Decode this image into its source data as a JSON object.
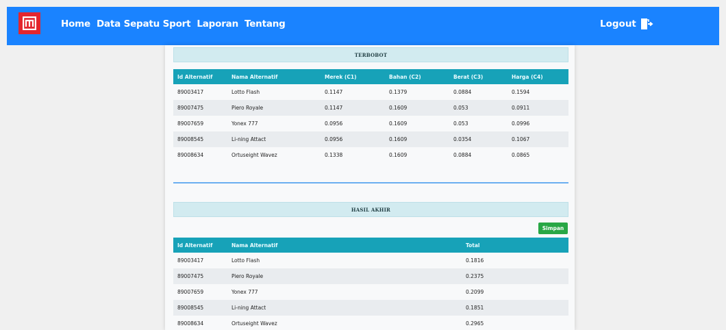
{
  "nav": {
    "items": [
      {
        "label": "Home"
      },
      {
        "label": "Data Sepatu Sport"
      },
      {
        "label": "Laporan"
      },
      {
        "label": "Tentang"
      }
    ],
    "logout_label": "Logout"
  },
  "terbobot": {
    "title": "TERBOBOT",
    "headers": [
      "Id Alternatif",
      "Nama Alternatif",
      "Merek (C1)",
      "Bahan (C2)",
      "Berat (C3)",
      "Harga (C4)"
    ],
    "rows": [
      [
        "89003417",
        "Lotto Flash",
        "0.1147",
        "0.1379",
        "0.0884",
        "0.1594"
      ],
      [
        "89007475",
        "Piero Royale",
        "0.1147",
        "0.1609",
        "0.053",
        "0.0911"
      ],
      [
        "89007659",
        "Yonex 777",
        "0.0956",
        "0.1609",
        "0.053",
        "0.0996"
      ],
      [
        "89008545",
        "Li-ning Attact",
        "0.0956",
        "0.1609",
        "0.0354",
        "0.1067"
      ],
      [
        "89008634",
        "Ortuseight Wavez",
        "0.1338",
        "0.1609",
        "0.0884",
        "0.0865"
      ]
    ]
  },
  "hasil": {
    "title": "HASIL AKHIR",
    "save_label": "Simpan",
    "headers": [
      "Id Alternatif",
      "Nama Alternatif",
      "Total"
    ],
    "rows": [
      [
        "89003417",
        "Lotto Flash",
        "0.1816"
      ],
      [
        "89007475",
        "Piero Royale",
        "0.2375"
      ],
      [
        "89007659",
        "Yonex 777",
        "0.2099"
      ],
      [
        "89008545",
        "Li-ning Attact",
        "0.1851"
      ],
      [
        "89008634",
        "Ortuseight Wavez",
        "0.2965"
      ]
    ]
  }
}
